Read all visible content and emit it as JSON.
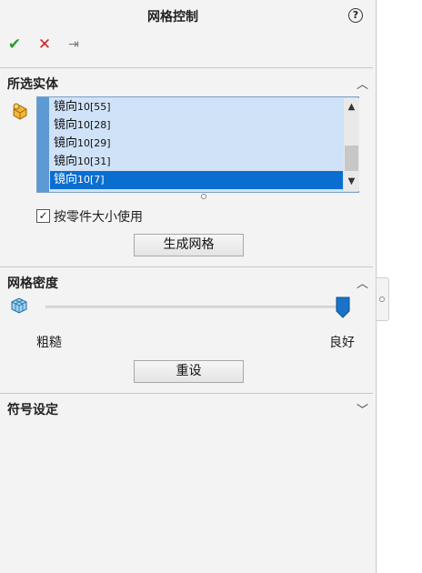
{
  "header": {
    "title": "网格控制",
    "help_label": "?"
  },
  "actions": {
    "ok": "✔",
    "cancel": "✕",
    "pin": "⇥"
  },
  "selected_entities": {
    "section_title": "所选实体",
    "chevron": "︿",
    "items": [
      {
        "prefix": "镜向",
        "num": "10[55]"
      },
      {
        "prefix": "镜向",
        "num": "10[28]"
      },
      {
        "prefix": "镜向",
        "num": "10[29]"
      },
      {
        "prefix": "镜向",
        "num": "10[31]"
      },
      {
        "prefix": "镜向",
        "num": "10[7]"
      }
    ],
    "selected_index": 4,
    "checkbox_label": "按零件大小使用",
    "checkbox_checked": true,
    "checkbox_mark": "✓",
    "create_mesh_button": "生成网格"
  },
  "mesh_density": {
    "section_title": "网格密度",
    "chevron": "︿",
    "coarse_label": "粗糙",
    "fine_label": "良好",
    "slider_fraction": 1.0,
    "reset_button": "重设"
  },
  "symbol_settings": {
    "section_title": "符号设定",
    "chevron": "﹀"
  },
  "colors": {
    "accent": "#0a6ed1",
    "ok_green": "#2a9d2a",
    "cancel_red": "#d62020"
  }
}
